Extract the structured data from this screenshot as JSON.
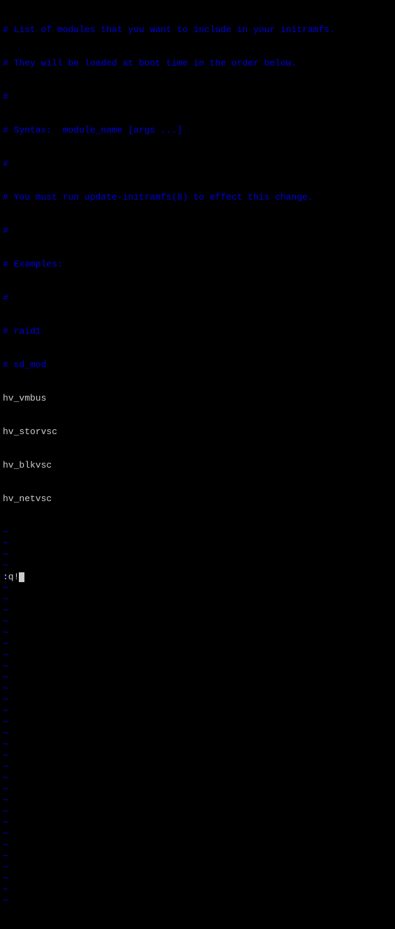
{
  "comments": [
    "# List of modules that you want to include in your initramfs.",
    "# They will be loaded at boot time in the order below.",
    "#",
    "# Syntax:  module_name [args ...]",
    "#",
    "# You must run update-initramfs(8) to effect this change.",
    "#",
    "# Examples:",
    "#",
    "# raid1",
    "# sd_mod"
  ],
  "modules": [
    "hv_vmbus",
    "hv_storvsc",
    "hv_blkvsc",
    "hv_netvsc"
  ],
  "tilde": "~",
  "cmdline": ":q!",
  "empty_line_count": 34
}
